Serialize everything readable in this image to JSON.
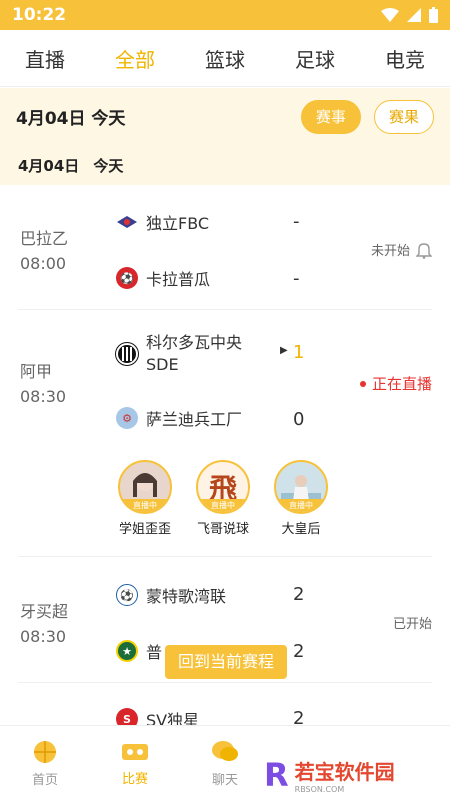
{
  "statusbar": {
    "time": "10:22"
  },
  "tabs": [
    {
      "label": "直播"
    },
    {
      "label": "全部"
    },
    {
      "label": "篮球"
    },
    {
      "label": "足球"
    },
    {
      "label": "电竞"
    }
  ],
  "datebar": {
    "date": "4月04日  今天",
    "btn_events": "赛事",
    "btn_results": "赛果"
  },
  "subdate": {
    "date": "4月04日",
    "today": "今天"
  },
  "matches": [
    {
      "league": "巴拉乙",
      "time": "08:00",
      "home": {
        "name": "独立FBC",
        "score": "-"
      },
      "away": {
        "name": "卡拉普瓜",
        "score": "-"
      },
      "status": "未开始"
    },
    {
      "league": "阿甲",
      "time": "08:30",
      "home": {
        "name": "科尔多瓦中央",
        "name2": "SDE",
        "score": "1"
      },
      "away": {
        "name": "萨兰迪兵工厂",
        "score": "0"
      },
      "status": "正在直播",
      "anchors": [
        {
          "name": "学姐歪歪",
          "tag": "直播中"
        },
        {
          "name": "飞哥说球",
          "tag": "直播中"
        },
        {
          "name": "大皇后",
          "tag": "直播中"
        }
      ]
    },
    {
      "league": "牙买超",
      "time": "08:30",
      "home": {
        "name": "蒙特歌湾联",
        "score": "2"
      },
      "away": {
        "name": "普",
        "score": "2"
      },
      "status": "已开始"
    },
    {
      "home": {
        "name": "SV独星",
        "score": "2"
      }
    }
  ],
  "toast": "回到当前赛程",
  "nav": [
    {
      "label": "首页"
    },
    {
      "label": "比赛"
    },
    {
      "label": "聊天"
    }
  ],
  "watermark": {
    "brand": "若宝软件园",
    "sub": "RBSON.COM"
  },
  "colors": {
    "accent": "#f7c23a",
    "live": "#e8332f"
  }
}
